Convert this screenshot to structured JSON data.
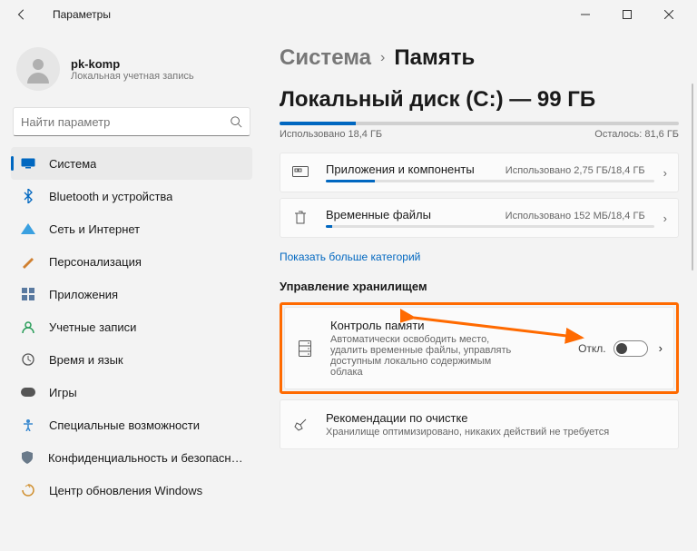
{
  "window": {
    "title": "Параметры"
  },
  "account": {
    "name": "pk-komp",
    "type": "Локальная учетная запись"
  },
  "search": {
    "placeholder": "Найти параметр"
  },
  "nav": {
    "items": [
      {
        "label": "Система",
        "icon": "system-icon",
        "active": true
      },
      {
        "label": "Bluetooth и устройства",
        "icon": "bluetooth-icon"
      },
      {
        "label": "Сеть и Интернет",
        "icon": "network-icon"
      },
      {
        "label": "Персонализация",
        "icon": "personalization-icon"
      },
      {
        "label": "Приложения",
        "icon": "apps-icon"
      },
      {
        "label": "Учетные записи",
        "icon": "accounts-icon"
      },
      {
        "label": "Время и язык",
        "icon": "time-icon"
      },
      {
        "label": "Игры",
        "icon": "gaming-icon"
      },
      {
        "label": "Специальные возможности",
        "icon": "accessibility-icon"
      },
      {
        "label": "Конфиденциальность и безопасность",
        "icon": "privacy-icon"
      },
      {
        "label": "Центр обновления Windows",
        "icon": "update-icon"
      }
    ]
  },
  "breadcrumb": {
    "parent": "Система",
    "current": "Память"
  },
  "disk": {
    "title": "Локальный диск (C:) — 99 ГБ",
    "used_label": "Использовано 18,4 ГБ",
    "free_label": "Осталось: 81,6 ГБ",
    "used_percent": 19
  },
  "categories": [
    {
      "title": "Приложения и компоненты",
      "usage": "Использовано 2,75 ГБ/18,4 ГБ",
      "percent": 15,
      "icon": "apps-components-icon"
    },
    {
      "title": "Временные файлы",
      "usage": "Использовано 152 МБ/18,4 ГБ",
      "percent": 1,
      "icon": "trash-icon"
    }
  ],
  "more_link": "Показать больше категорий",
  "storage_mgmt": {
    "heading": "Управление хранилищем",
    "storage_sense": {
      "title": "Контроль памяти",
      "desc": "Автоматически освободить место, удалить временные файлы, управлять доступным локально содержимым облака",
      "state_label": "Откл.",
      "on": false
    },
    "cleanup": {
      "title": "Рекомендации по очистке",
      "desc": "Хранилище оптимизировано, никаких действий не требуется"
    }
  },
  "chart_data": {
    "type": "bar",
    "title": "Локальный диск (C:) — 99 ГБ",
    "series": [
      {
        "name": "Использовано",
        "values": [
          18.4
        ],
        "unit": "ГБ"
      },
      {
        "name": "Осталось",
        "values": [
          81.6
        ],
        "unit": "ГБ"
      }
    ],
    "total": 99,
    "breakdown": [
      {
        "name": "Приложения и компоненты",
        "value": 2.75,
        "total": 18.4,
        "unit": "ГБ"
      },
      {
        "name": "Временные файлы",
        "value": 152,
        "total": 18841.6,
        "unit": "МБ"
      }
    ]
  }
}
